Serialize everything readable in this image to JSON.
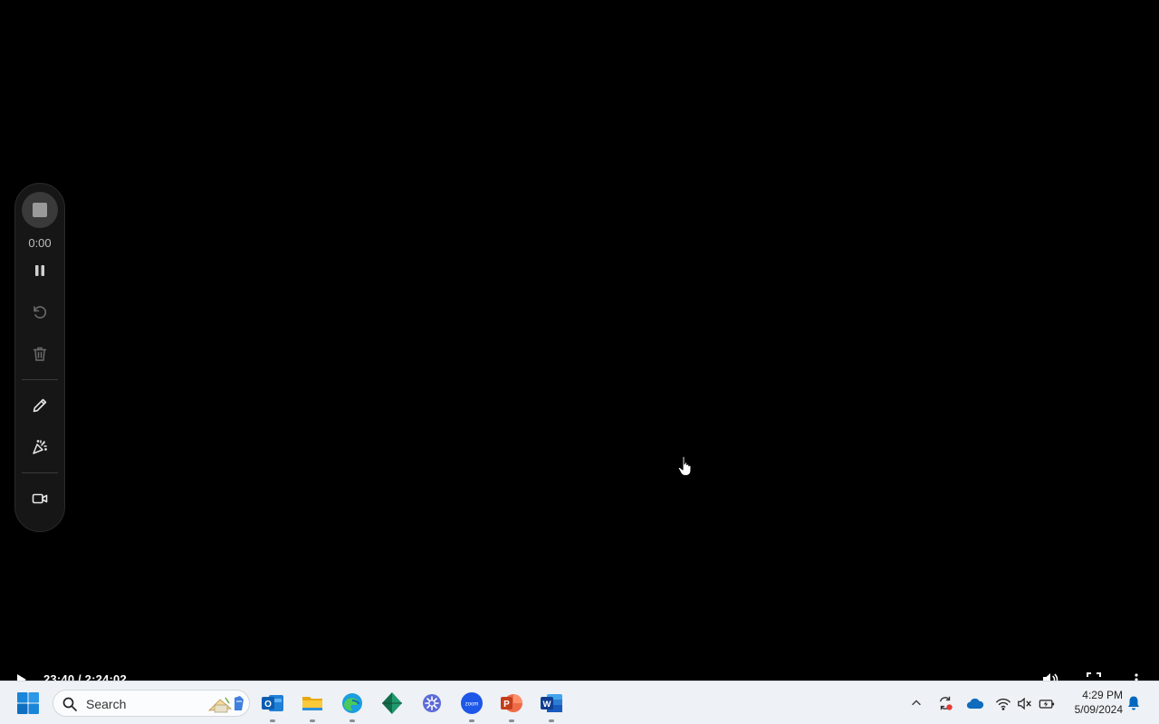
{
  "recorder": {
    "timer": "0:00",
    "tools": [
      "stop",
      "pause",
      "restart",
      "delete",
      "draw",
      "effects",
      "camera"
    ]
  },
  "video_player": {
    "time": "23:40 / 2:24:02"
  },
  "taskbar": {
    "search_label": "Search",
    "pinned_apps": [
      "Outlook",
      "File Explorer",
      "Microsoft Edge",
      "Diamond app",
      "Settings",
      "Zoom",
      "PowerPoint",
      "Word"
    ],
    "clock_time": "4:29 PM",
    "clock_date": "5/09/2024",
    "accent": "#0067c0"
  }
}
